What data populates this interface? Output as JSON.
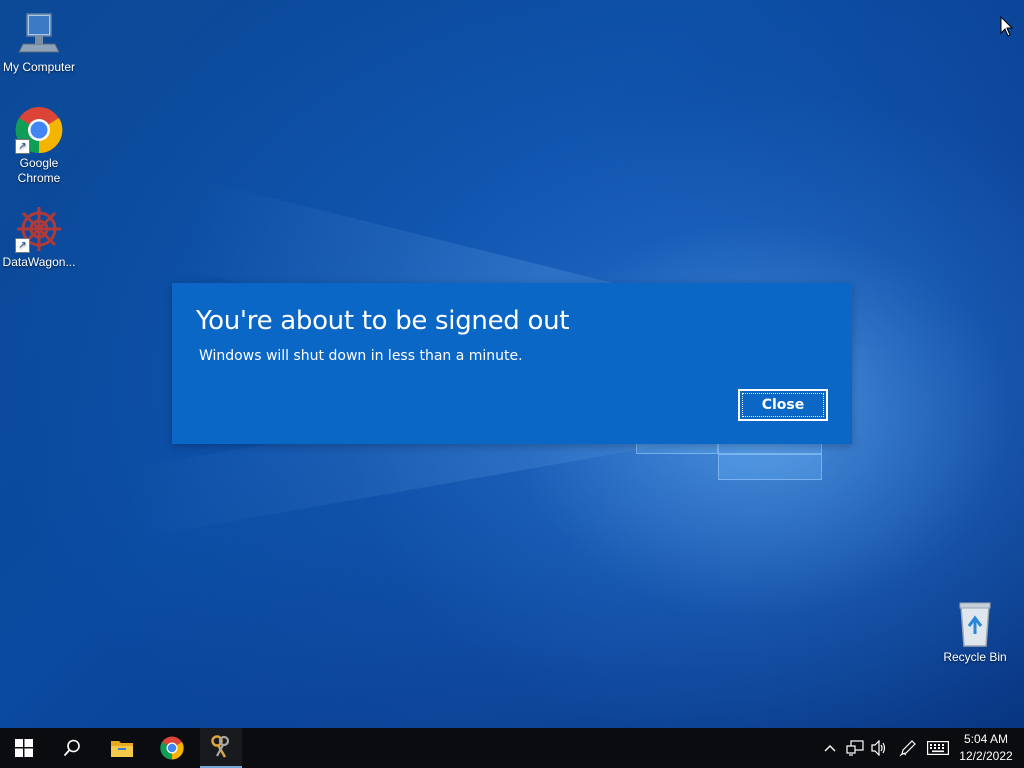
{
  "desktop": {
    "icons": [
      {
        "label": "My Computer"
      },
      {
        "label": "Google\nChrome"
      },
      {
        "label": "DataWagon..."
      },
      {
        "label": "Recycle Bin"
      }
    ]
  },
  "dialog": {
    "title": "You're about to be signed out",
    "message": "Windows will shut down in less than a minute.",
    "close_label": "Close",
    "background": "#0a67c6"
  },
  "taskbar": {
    "items": [
      "windows-start-icon",
      "search-icon",
      "file-explorer-icon",
      "chrome-icon",
      "keys-app-icon"
    ],
    "tray": [
      "chevron-up-icon",
      "network-icon",
      "volume-icon",
      "pen-icon",
      "keyboard-icon"
    ],
    "time": "5:04 AM",
    "date": "12/2/2022"
  }
}
